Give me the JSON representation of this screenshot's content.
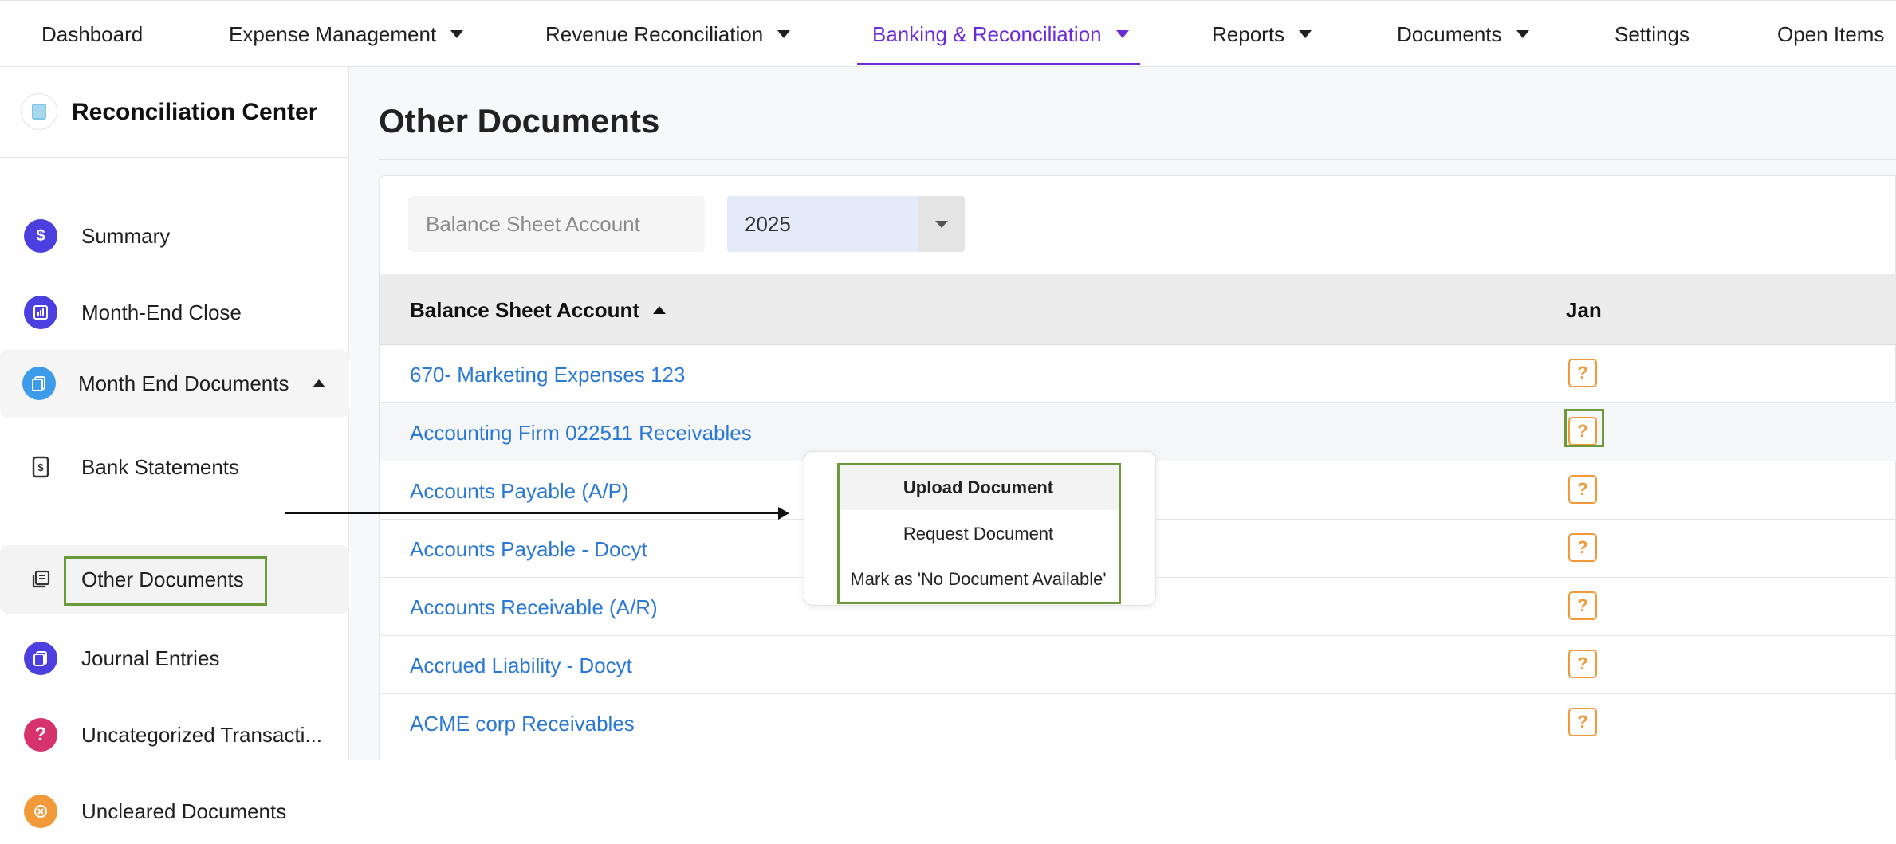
{
  "nav": {
    "items": [
      {
        "label": "Dashboard"
      },
      {
        "label": "Expense Management"
      },
      {
        "label": "Revenue Reconciliation"
      },
      {
        "label": "Banking & Reconciliation"
      },
      {
        "label": "Reports"
      },
      {
        "label": "Documents"
      },
      {
        "label": "Settings"
      },
      {
        "label": "Open Items"
      }
    ],
    "active": "Banking & Reconciliation",
    "accent_color": "#6c2bd9"
  },
  "sidebar": {
    "title": "Reconciliation Center",
    "items": [
      {
        "label": "Summary",
        "icon": "dollar-doc-icon",
        "color": "#4b3fe0"
      },
      {
        "label": "Month-End Close",
        "icon": "chart-icon",
        "color": "#4b3fe0"
      },
      {
        "label": "Month End Documents",
        "icon": "documents-icon",
        "color": "#3d9be9"
      },
      {
        "label": "Bank Statements",
        "icon": "statement-icon"
      },
      {
        "label": "Other Documents",
        "icon": "other-docs-icon"
      },
      {
        "label": "Journal Entries",
        "icon": "journal-icon",
        "color": "#4b3fe0"
      },
      {
        "label": "Uncategorized Transacti...",
        "icon": "question-icon",
        "color": "#d6336c"
      },
      {
        "label": "Uncleared Documents",
        "icon": "uncleared-icon",
        "color": "#f2993a"
      }
    ]
  },
  "main": {
    "title": "Other Documents",
    "filter": {
      "placeholder": "Balance Sheet Account",
      "year": "2025"
    },
    "table": {
      "columns": [
        "Balance Sheet Account",
        "Jan"
      ],
      "rows": [
        {
          "account": "670- Marketing Expenses 123",
          "jan": "?"
        },
        {
          "account": "Accounting Firm 022511 Receivables",
          "jan": "?"
        },
        {
          "account": "Accounts Payable (A/P)",
          "jan": "?"
        },
        {
          "account": "Accounts Payable - Docyt",
          "jan": "?"
        },
        {
          "account": "Accounts Receivable (A/R)",
          "jan": "?"
        },
        {
          "account": "Accrued Liability - Docyt",
          "jan": "?"
        },
        {
          "account": "ACME corp Receivables",
          "jan": "?"
        }
      ]
    },
    "menu": {
      "items": [
        "Upload Document",
        "Request Document",
        "Mark as 'No Document Available'"
      ]
    }
  }
}
